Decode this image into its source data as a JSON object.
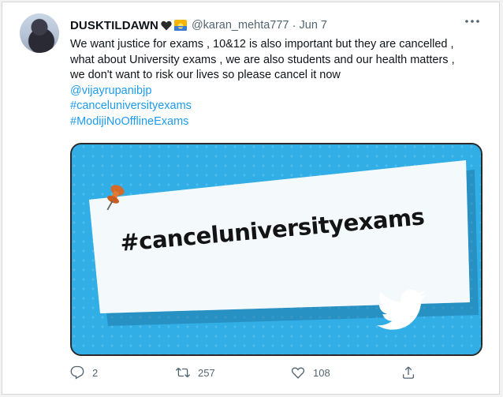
{
  "tweet": {
    "display_name": "DUSKTILDAWN",
    "handle": "@karan_mehta777",
    "separator": "·",
    "date": "Jun 7",
    "text_lines": [
      "We want justice for exams , 10&12 is also important but they are cancelled ,",
      "what about University exams , we are also students and our health matters ,",
      "we don't want to risk our lives so please cancel it now"
    ],
    "mention": "@vijayrupanibjp",
    "hashtags": [
      "#canceluniversityexams",
      "#ModijiNoOfflineExams"
    ],
    "media": {
      "banner_text": "#canceluniversityexams",
      "icons": [
        "pushpin-icon",
        "twitter-bird-icon"
      ]
    },
    "actions": {
      "reply_count": "2",
      "retweet_count": "257",
      "like_count": "108"
    },
    "icons": {
      "heart": "black-heart-icon",
      "sun": "sunrise-icon",
      "more": "more-options-icon",
      "reply": "reply-icon",
      "retweet": "retweet-icon",
      "like": "like-icon",
      "share": "share-icon"
    },
    "colors": {
      "link": "#1d9bf0",
      "media_bg": "#31aee6",
      "text": "#0f1419",
      "muted": "#536471"
    }
  }
}
